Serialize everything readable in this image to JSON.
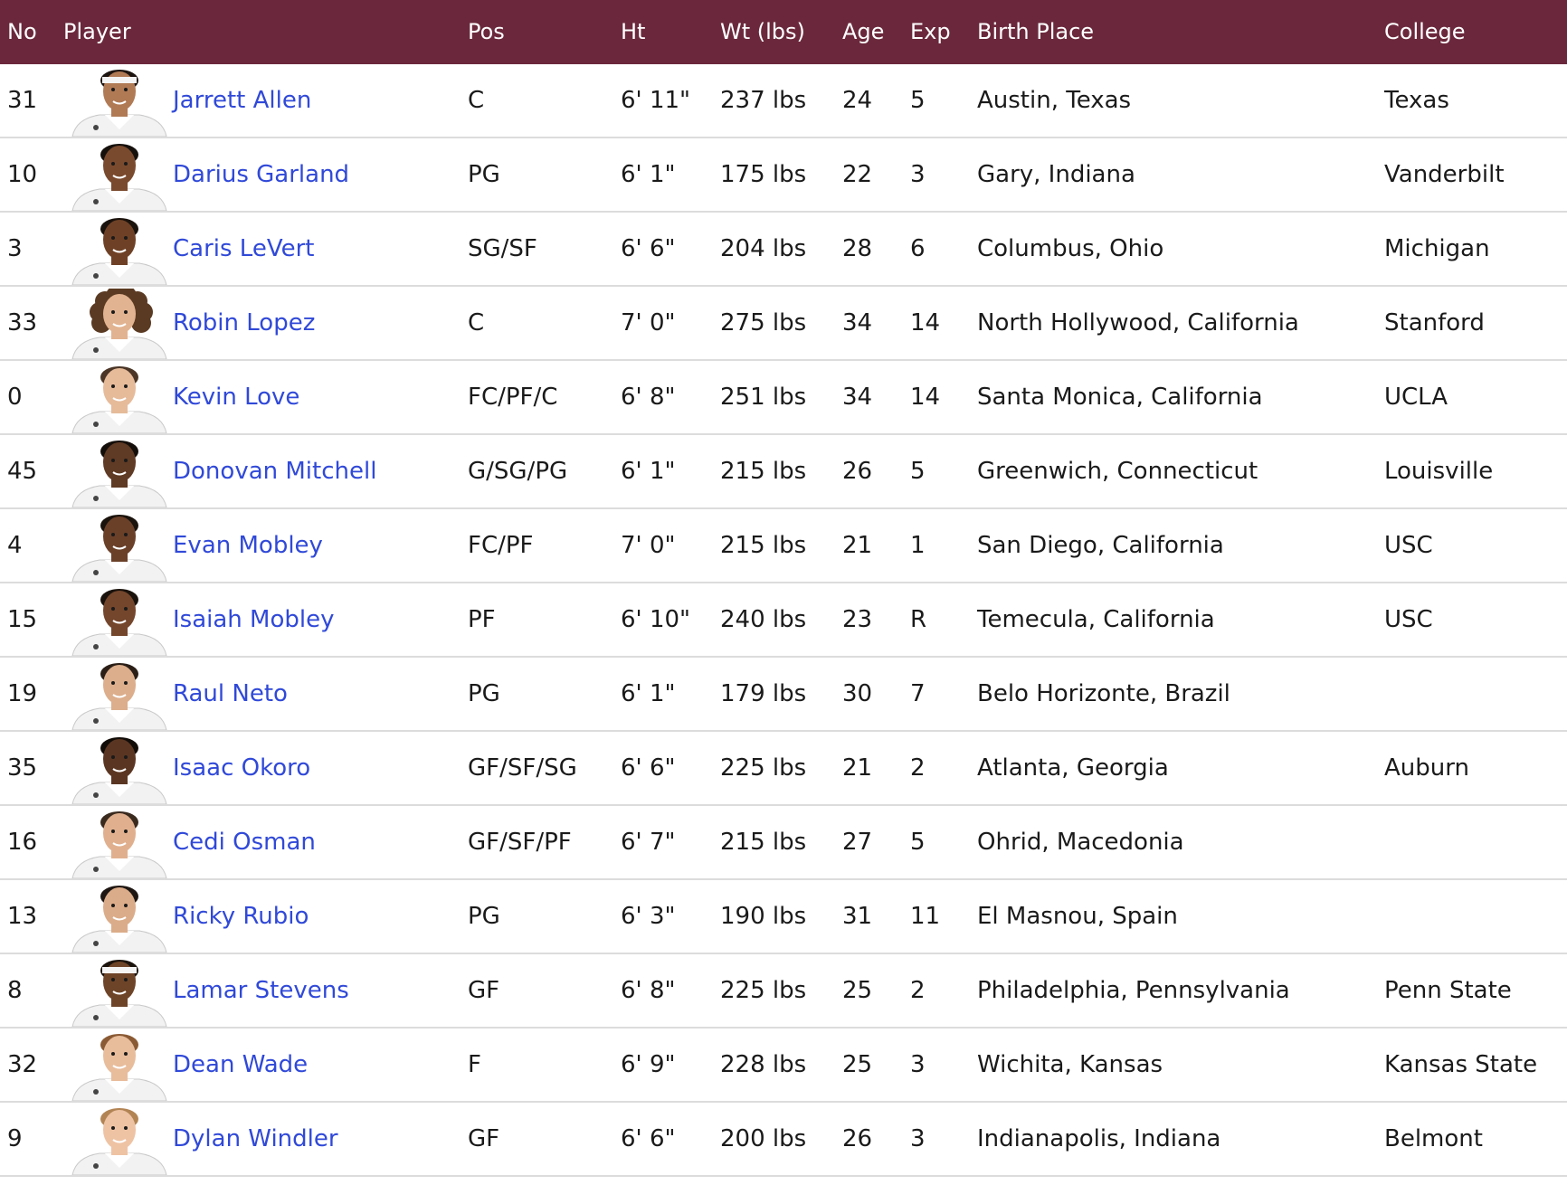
{
  "header": {
    "no": "No",
    "player": "Player",
    "pos": "Pos",
    "ht": "Ht",
    "wt": "Wt (lbs)",
    "age": "Age",
    "exp": "Exp",
    "birth_place": "Birth Place",
    "college": "College"
  },
  "colors": {
    "header_bg": "#6b283c",
    "link": "#3049d8",
    "divider": "#dcdcdc"
  },
  "players": [
    {
      "no": "31",
      "name": "Jarrett Allen",
      "pos": "C",
      "ht": "6' 11\"",
      "wt": "237 lbs",
      "age": "24",
      "exp": "5",
      "birth_place": "Austin, Texas",
      "college": "Texas",
      "skin": "#b07a55",
      "hair": "#1c1410",
      "headband": true
    },
    {
      "no": "10",
      "name": "Darius Garland",
      "pos": "PG",
      "ht": "6' 1\"",
      "wt": "175 lbs",
      "age": "22",
      "exp": "3",
      "birth_place": "Gary, Indiana",
      "college": "Vanderbilt",
      "skin": "#7a4a2e",
      "hair": "#15100c"
    },
    {
      "no": "3",
      "name": "Caris LeVert",
      "pos": "SG/SF",
      "ht": "6' 6\"",
      "wt": "204 lbs",
      "age": "28",
      "exp": "6",
      "birth_place": "Columbus, Ohio",
      "college": "Michigan",
      "skin": "#6e4126",
      "hair": "#1a120c"
    },
    {
      "no": "33",
      "name": "Robin Lopez",
      "pos": "C",
      "ht": "7' 0\"",
      "wt": "275 lbs",
      "age": "34",
      "exp": "14",
      "birth_place": "North Hollywood, California",
      "college": "Stanford",
      "skin": "#e2b390",
      "hair": "#5a3a22",
      "curly": true
    },
    {
      "no": "0",
      "name": "Kevin Love",
      "pos": "FC/PF/C",
      "ht": "6' 8\"",
      "wt": "251 lbs",
      "age": "34",
      "exp": "14",
      "birth_place": "Santa Monica, California",
      "college": "UCLA",
      "skin": "#e6bb9a",
      "hair": "#4a3526"
    },
    {
      "no": "45",
      "name": "Donovan Mitchell",
      "pos": "G/SG/PG",
      "ht": "6' 1\"",
      "wt": "215 lbs",
      "age": "26",
      "exp": "5",
      "birth_place": "Greenwich, Connecticut",
      "college": "Louisville",
      "skin": "#5f3a24",
      "hair": "#140e0a"
    },
    {
      "no": "4",
      "name": "Evan Mobley",
      "pos": "FC/PF",
      "ht": "7' 0\"",
      "wt": "215 lbs",
      "age": "21",
      "exp": "1",
      "birth_place": "San Diego, California",
      "college": "USC",
      "skin": "#6a4029",
      "hair": "#1a120c"
    },
    {
      "no": "15",
      "name": "Isaiah Mobley",
      "pos": "PF",
      "ht": "6' 10\"",
      "wt": "240 lbs",
      "age": "23",
      "exp": "R",
      "birth_place": "Temecula, California",
      "college": "USC",
      "skin": "#74462c",
      "hair": "#1a120c"
    },
    {
      "no": "19",
      "name": "Raul Neto",
      "pos": "PG",
      "ht": "6' 1\"",
      "wt": "179 lbs",
      "age": "30",
      "exp": "7",
      "birth_place": "Belo Horizonte, Brazil",
      "college": "",
      "skin": "#dcae8c",
      "hair": "#2a1e16"
    },
    {
      "no": "35",
      "name": "Isaac Okoro",
      "pos": "GF/SF/SG",
      "ht": "6' 6\"",
      "wt": "225 lbs",
      "age": "21",
      "exp": "2",
      "birth_place": "Atlanta, Georgia",
      "college": "Auburn",
      "skin": "#5a3622",
      "hair": "#120c08"
    },
    {
      "no": "16",
      "name": "Cedi Osman",
      "pos": "GF/SF/PF",
      "ht": "6' 7\"",
      "wt": "215 lbs",
      "age": "27",
      "exp": "5",
      "birth_place": "Ohrid, Macedonia",
      "college": "",
      "skin": "#e0b08e",
      "hair": "#3a2a1e"
    },
    {
      "no": "13",
      "name": "Ricky Rubio",
      "pos": "PG",
      "ht": "6' 3\"",
      "wt": "190 lbs",
      "age": "31",
      "exp": "11",
      "birth_place": "El Masnou, Spain",
      "college": "",
      "skin": "#dbac89",
      "hair": "#1e1612"
    },
    {
      "no": "8",
      "name": "Lamar Stevens",
      "pos": "GF",
      "ht": "6' 8\"",
      "wt": "225 lbs",
      "age": "25",
      "exp": "2",
      "birth_place": "Philadelphia, Pennsylvania",
      "college": "Penn State",
      "skin": "#6e4428",
      "hair": "#1a120c",
      "headband": true
    },
    {
      "no": "32",
      "name": "Dean Wade",
      "pos": "F",
      "ht": "6' 9\"",
      "wt": "228 lbs",
      "age": "25",
      "exp": "3",
      "birth_place": "Wichita, Kansas",
      "college": "Kansas State",
      "skin": "#e8bd9c",
      "hair": "#8a5a34"
    },
    {
      "no": "9",
      "name": "Dylan Windler",
      "pos": "GF",
      "ht": "6' 6\"",
      "wt": "200 lbs",
      "age": "26",
      "exp": "3",
      "birth_place": "Indianapolis, Indiana",
      "college": "Belmont",
      "skin": "#eec3a4",
      "hair": "#b28454"
    }
  ]
}
